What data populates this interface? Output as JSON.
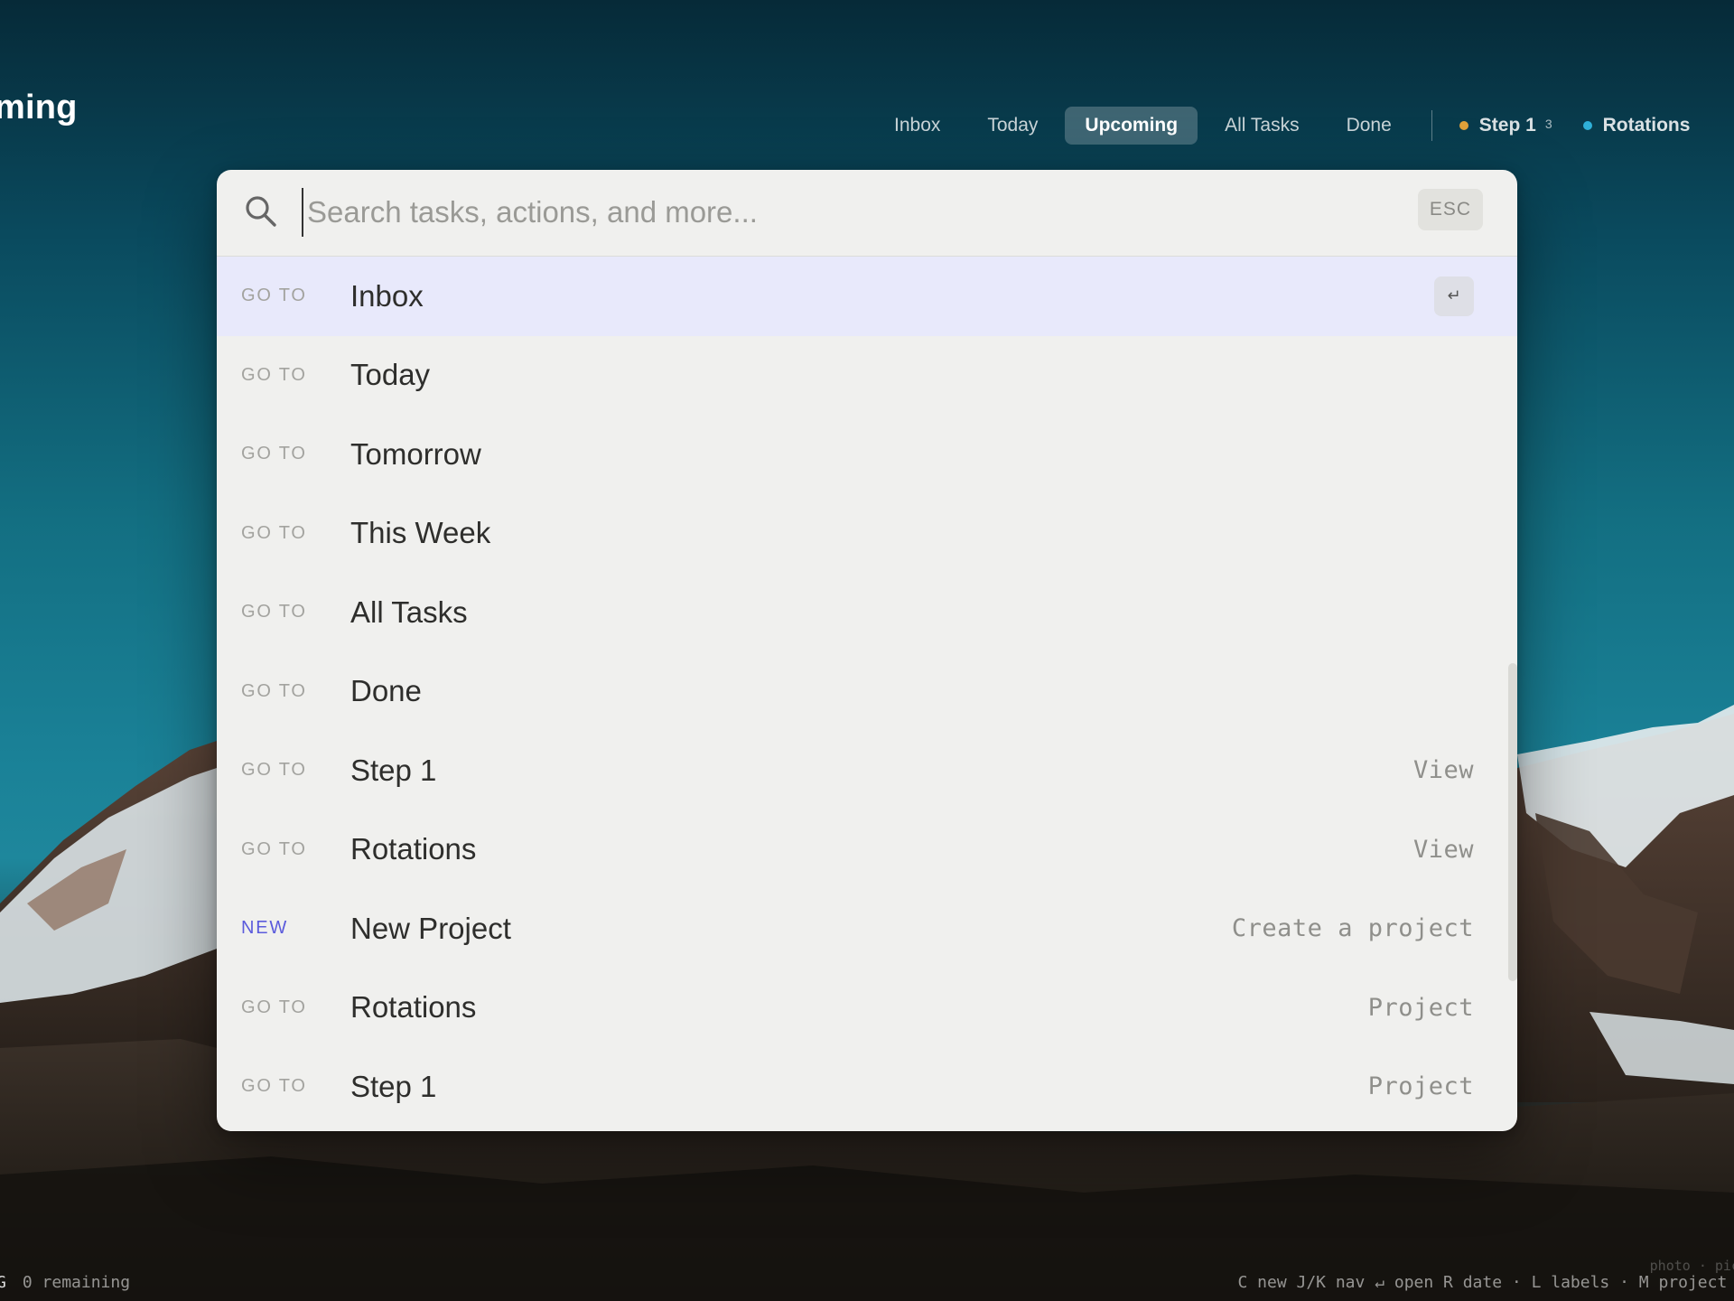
{
  "app": {
    "title": "ming"
  },
  "nav": {
    "tabs": [
      {
        "label": "Inbox",
        "active": false
      },
      {
        "label": "Today",
        "active": false
      },
      {
        "label": "Upcoming",
        "active": true
      },
      {
        "label": "All Tasks",
        "active": false
      },
      {
        "label": "Done",
        "active": false
      }
    ],
    "projects": [
      {
        "label": "Step 1",
        "count": "3",
        "color": "#e0a23a"
      },
      {
        "label": "Rotations",
        "count": "",
        "color": "#2fb0d8"
      }
    ]
  },
  "palette": {
    "search": {
      "placeholder": "Search tasks, actions, and more...",
      "value": "",
      "esc_label": "ESC",
      "icon": "search-icon"
    },
    "enter_key_glyph": "↵",
    "results": [
      {
        "kind": "GO TO",
        "label": "Inbox",
        "hint": "",
        "selected": true
      },
      {
        "kind": "GO TO",
        "label": "Today",
        "hint": ""
      },
      {
        "kind": "GO TO",
        "label": "Tomorrow",
        "hint": ""
      },
      {
        "kind": "GO TO",
        "label": "This Week",
        "hint": ""
      },
      {
        "kind": "GO TO",
        "label": "All Tasks",
        "hint": ""
      },
      {
        "kind": "GO TO",
        "label": "Done",
        "hint": ""
      },
      {
        "kind": "GO TO",
        "label": "Step 1",
        "hint": "View"
      },
      {
        "kind": "GO TO",
        "label": "Rotations",
        "hint": "View"
      },
      {
        "kind": "NEW",
        "label": "New Project",
        "hint": "Create a project"
      },
      {
        "kind": "GO TO",
        "label": "Rotations",
        "hint": "Project"
      },
      {
        "kind": "GO TO",
        "label": "Step 1",
        "hint": "Project"
      }
    ]
  },
  "footer": {
    "left_glyph": "G",
    "remaining": "0 remaining",
    "shortcuts": "C new  J/K nav  ↵ open  R date · L labels · M project  #",
    "photo_credit": "photo · pic"
  },
  "colors": {
    "accent": "#5b5bdc",
    "selected_row": "#e8e9fb",
    "palette_bg": "#f0f0ee"
  }
}
